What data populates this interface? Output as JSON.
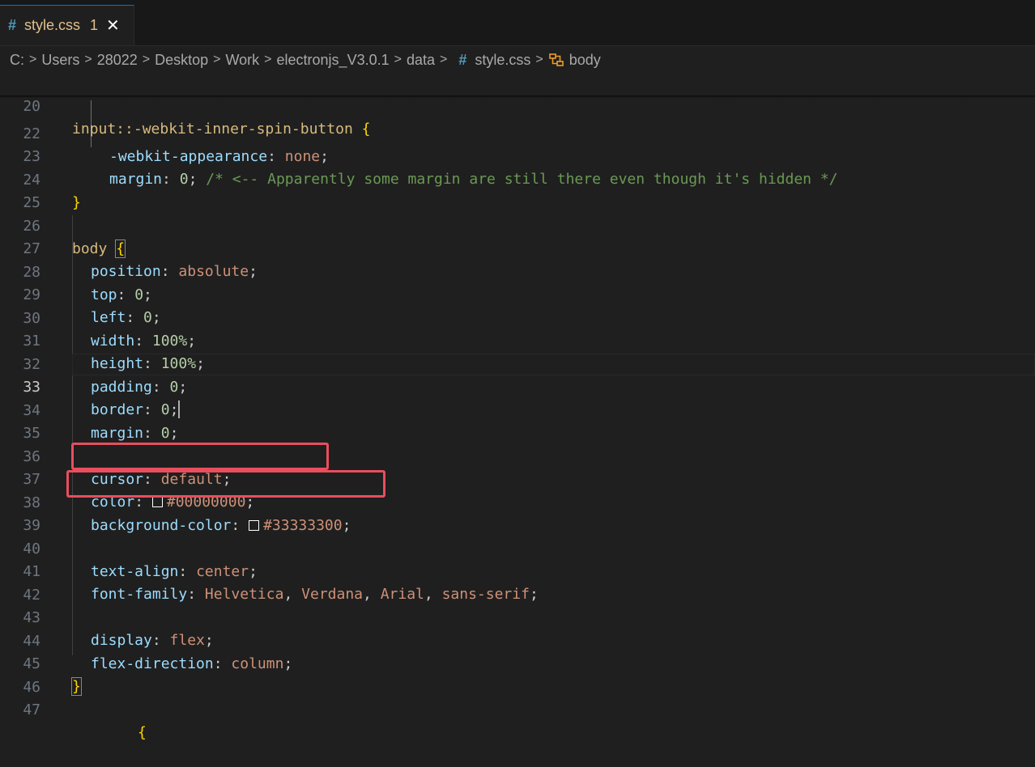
{
  "tab": {
    "icon": "css-hash-icon",
    "hash": "#",
    "filename": "style.css",
    "problems": "1",
    "close": "✕"
  },
  "breadcrumb": {
    "items": [
      "C:",
      "Users",
      "28022",
      "Desktop",
      "Work",
      "electronjs_V3.0.1",
      "data"
    ],
    "file_hash": "#",
    "file": "style.css",
    "symbol": "body"
  },
  "editor": {
    "sticky": {
      "ln": "20",
      "selector": "input::-webkit-inner-spin-button",
      "brace": "{"
    },
    "lines": {
      "l22": {
        "ln": "22",
        "prop": "-webkit-appearance",
        "value": "none"
      },
      "l23": {
        "ln": "23",
        "prop": "margin",
        "value": "0",
        "comment": "/* <-- Apparently some margin are still there even though it's hidden */"
      },
      "l24": {
        "ln": "24",
        "brace": "}"
      },
      "l25": {
        "ln": "25"
      },
      "l26": {
        "ln": "26",
        "selector": "body",
        "brace": "{"
      },
      "l27": {
        "ln": "27",
        "prop": "position",
        "value": "absolute"
      },
      "l28": {
        "ln": "28",
        "prop": "top",
        "value": "0"
      },
      "l29": {
        "ln": "29",
        "prop": "left",
        "value": "0"
      },
      "l30": {
        "ln": "30",
        "prop": "width",
        "value": "100%"
      },
      "l31": {
        "ln": "31",
        "prop": "height",
        "value": "100%"
      },
      "l32": {
        "ln": "32",
        "prop": "padding",
        "value": "0"
      },
      "l33": {
        "ln": "33",
        "prop": "border",
        "value": "0"
      },
      "l34": {
        "ln": "34",
        "prop": "margin",
        "value": "0"
      },
      "l35": {
        "ln": "35"
      },
      "l36": {
        "ln": "36",
        "prop": "cursor",
        "value": "default"
      },
      "l37": {
        "ln": "37",
        "prop": "color",
        "value": "#00000000",
        "swatch": "#00000000"
      },
      "l38": {
        "ln": "38",
        "prop": "background-color",
        "value": "#33333300",
        "swatch": "#33333300"
      },
      "l39": {
        "ln": "39"
      },
      "l40": {
        "ln": "40",
        "prop": "text-align",
        "value": "center"
      },
      "l41": {
        "ln": "41",
        "prop": "font-family",
        "v1": "Helvetica",
        "v2": "Verdana",
        "v3": "Arial",
        "v4": "sans-serif"
      },
      "l42": {
        "ln": "42"
      },
      "l43": {
        "ln": "43",
        "prop": "display",
        "value": "flex"
      },
      "l44": {
        "ln": "44",
        "prop": "flex-direction",
        "value": "column"
      },
      "l45": {
        "ln": "45",
        "brace": "}"
      },
      "l46": {
        "ln": "46"
      },
      "l47": {
        "ln": "47",
        "partial": "{"
      }
    }
  },
  "colors": {
    "annotation_box": "#e84e5e",
    "tab_accent": "#0078d4"
  }
}
